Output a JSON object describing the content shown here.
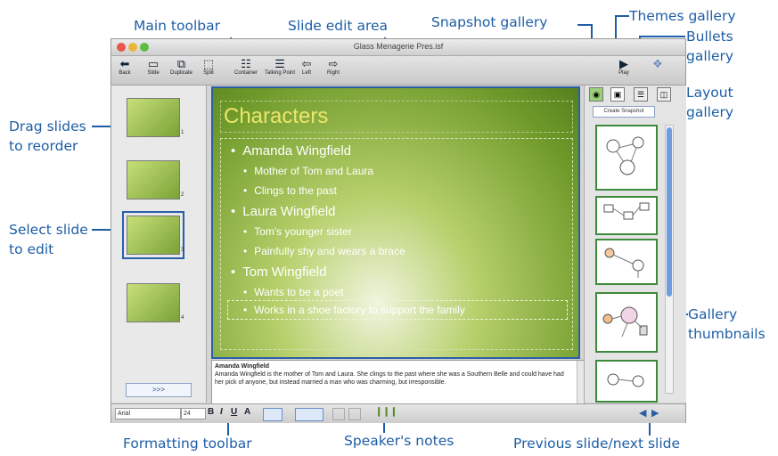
{
  "callouts": {
    "main_toolbar": "Main toolbar",
    "slide_edit_area": "Slide edit area",
    "snapshot_gallery": "Snapshot gallery",
    "themes_gallery": "Themes gallery",
    "bullets_gallery_1": "Bullets",
    "bullets_gallery_2": "gallery",
    "layout_gallery_1": "Layout",
    "layout_gallery_2": "gallery",
    "drag_slides_1": "Drag slides",
    "drag_slides_2": "to reorder",
    "select_slide_1": "Select slide",
    "select_slide_2": "to edit",
    "gallery_thumbnails_1": "Gallery",
    "gallery_thumbnails_2": "thumbnails",
    "formatting_toolbar": "Formatting toolbar",
    "speakers_notes": "Speaker's notes",
    "prev_next_slide": "Previous slide/next slide"
  },
  "window": {
    "title": "Glass Menagerie Pres.isf"
  },
  "toolbar": {
    "back": "Back",
    "slide": "Slide",
    "duplicate": "Duplicate",
    "split": "Split",
    "container": "Container",
    "talking_point": "Talking Point",
    "left": "Left",
    "right": "Right",
    "play": "Play"
  },
  "sorter": {
    "slide_numbers": [
      "1",
      "2",
      "3",
      "4"
    ],
    "more_button": ">>>"
  },
  "slide": {
    "title": "Characters",
    "bullets": [
      "Amanda Wingfield",
      "Mother of Tom and Laura",
      "Clings to the past",
      "Laura Wingfield",
      "Tom's younger sister",
      "Painfully shy and wears a brace",
      "Tom Wingfield",
      "Wants to be a poet",
      "Works in a shoe factory to support the family"
    ]
  },
  "notes": {
    "heading": "Amanda Wingfield",
    "text": "Amanda Wingfield is the mother of Tom and Laura. She clings to the past where she was a Southern Belle and could have had her pick of anyone, but instead married a man who was charming, but irresponsible."
  },
  "gallery": {
    "create_snapshot": "Create Snapshot"
  },
  "format_bar": {
    "font": "Arial",
    "size": "24",
    "bold": "B",
    "italic": "I",
    "underline": "U",
    "text_color": "A"
  },
  "colors": {
    "callout_blue": "#1e5ea6",
    "slide_title": "#ece66c",
    "selection_blue": "#2a5fa8",
    "gallery_border": "#3d8a3d"
  }
}
